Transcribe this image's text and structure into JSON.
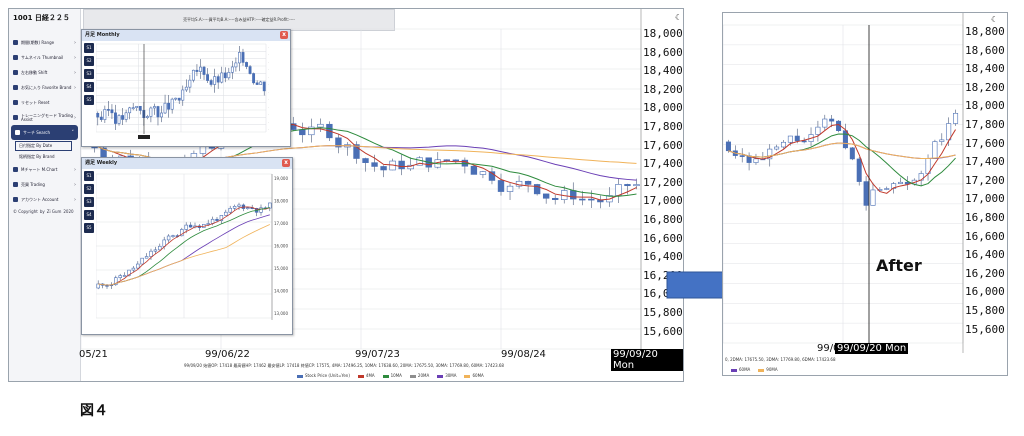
{
  "main": {
    "sidebar": {
      "title": "1001 日経２２５",
      "items": [
        {
          "label": "期間(期数) Range"
        },
        {
          "label": "サムネイル Thumbnail"
        },
        {
          "label": "左右移動 Shift"
        },
        {
          "label": "お気に入り Favorite Brand"
        },
        {
          "label": "リセット Reset"
        },
        {
          "label": "トレーニングモード Trading Assist"
        },
        {
          "label": "サーチ Search"
        },
        {
          "label": "Mチャート M.Chart"
        },
        {
          "label": "売買 Trading"
        },
        {
          "label": "アカウント Account"
        }
      ],
      "sub_items": [
        "日付指定 By Date",
        "銘柄指定 By Brand"
      ],
      "footer": [
        "© Copyright",
        "by",
        "Zi Gum",
        "2020"
      ]
    },
    "readout": "売平均S.A:----買平均B.A:----含み益HTP:----確定益R.Profit:----",
    "y_axis": [
      "18,000",
      "18,600",
      "18,400",
      "18,200",
      "18,000",
      "17,800",
      "17,600",
      "17,400",
      "17,200",
      "17,000",
      "16,800",
      "16,600",
      "16,400",
      "16,200",
      "16,000",
      "15,800",
      "15,600"
    ],
    "x_axis": [
      "05/21",
      "99/06/22",
      "99/07/23",
      "99/08/24"
    ],
    "current_date": "99/09/20 Mon",
    "bottom_line": "99/09/20 始値OP: 17418 最高値HP: 17462 最安値LP: 17418 終値CP: 17575, 4MA: 17496.25, 10MA: 17638.60, 20MA: 17675.50, 30MA: 17769.80, 60MA: 17423.68",
    "legend": [
      {
        "label": "Stock Price (Unit=Yen)",
        "color": "#4a6fb5"
      },
      {
        "label": "4MA",
        "color": "#c0392b"
      },
      {
        "label": "10MA",
        "color": "#2e8b3d"
      },
      {
        "label": "20MA",
        "color": "#8e8e8e"
      },
      {
        "label": "30MA",
        "color": "#6a3fb5"
      },
      {
        "label": "60MA",
        "color": "#f0b35a"
      }
    ],
    "popups": {
      "monthly": {
        "title": "月足 Monthly",
        "tabs": [
          "S1",
          "S2",
          "S3",
          "S4",
          "S5"
        ],
        "close": "x"
      },
      "weekly": {
        "title": "週足 Weekly",
        "tabs": [
          "S1",
          "S2",
          "S3",
          "S4",
          "S5"
        ],
        "close": "x",
        "y_axis": [
          "19,000",
          "18,000",
          "17,000",
          "16,000",
          "15,000",
          "14,000",
          "13,000"
        ]
      }
    }
  },
  "after": {
    "label": "After",
    "y_axis": [
      "18,800",
      "18,600",
      "18,400",
      "18,200",
      "18,000",
      "17,800",
      "17,600",
      "17,400",
      "17,200",
      "17,000",
      "16,800",
      "16,600",
      "16,400",
      "16,200",
      "16,000",
      "15,800",
      "15,600"
    ],
    "x_label_partial": "99/0",
    "current_date": "99/09/20 Mon",
    "bottom_line": "0, 2DMA: 17675.50, 3DMA: 17769.80, 6DMA: 17423.68",
    "legend": [
      {
        "label": "60MA",
        "color": "#6a3fb5"
      },
      {
        "label": "90MA",
        "color": "#f0b35a"
      }
    ]
  },
  "figure_label": "図４",
  "colors": {
    "candle_up": "#4a6fb5",
    "ma4": "#c0392b",
    "ma10": "#2e8b3d",
    "ma30": "#6a3fb5",
    "ma60": "#f0b35a",
    "arrow": "#4472c4"
  }
}
